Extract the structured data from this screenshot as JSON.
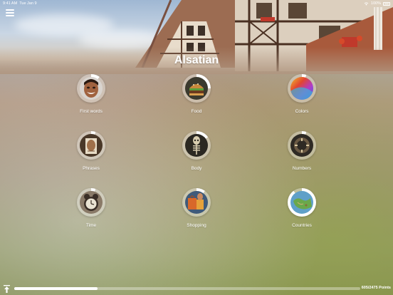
{
  "status_bar": {
    "time": "9:41 AM",
    "date": "Tue Jan 9",
    "battery": "100%"
  },
  "header": {
    "title": "Alsatian"
  },
  "topics": [
    {
      "label": "First words",
      "progress": 0.1
    },
    {
      "label": "Food",
      "progress": 0.25
    },
    {
      "label": "Colors",
      "progress": 0.05
    },
    {
      "label": "Phrases",
      "progress": 0.05
    },
    {
      "label": "Body",
      "progress": 0.15
    },
    {
      "label": "Numbers",
      "progress": 0.05
    },
    {
      "label": "Time",
      "progress": 0.05
    },
    {
      "label": "Shopping",
      "progress": 0.1
    },
    {
      "label": "Countries",
      "progress": 0.9
    }
  ],
  "footer": {
    "points": "605/2475 Points",
    "progress": 0.24
  },
  "colors": {
    "ring_done": "#ffffff",
    "ring_remaining": "rgba(255,255,255,0.35)"
  },
  "icons": {
    "menu": "hamburger-menu-icon",
    "upload": "upload-icon",
    "wifi": "wifi-icon",
    "battery": "battery-icon"
  }
}
